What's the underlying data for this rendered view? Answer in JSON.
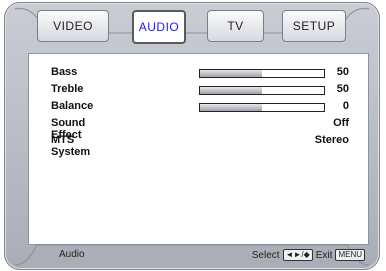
{
  "tabs": [
    {
      "label": "VIDEO",
      "active": false
    },
    {
      "label": "AUDIO",
      "active": true
    },
    {
      "label": "TV",
      "active": false
    },
    {
      "label": "SETUP",
      "active": false
    }
  ],
  "settings": [
    {
      "label": "Bass",
      "value": "50",
      "level": 0.5
    },
    {
      "label": "Treble",
      "value": "50",
      "level": 0.5
    },
    {
      "label": "Balance",
      "value": "0",
      "level": 0.5
    },
    {
      "label": "Sound Effect",
      "value": "Off"
    },
    {
      "label": "MTS System",
      "value": "Stereo"
    }
  ],
  "status": {
    "section": "Audio",
    "select_label": "Select",
    "select_keys": "◄►/◆",
    "exit_label": "Exit",
    "exit_key": "MENU"
  },
  "colors": {
    "active_tab_text": "#1a1aff",
    "frame": "#b4b8bf"
  }
}
